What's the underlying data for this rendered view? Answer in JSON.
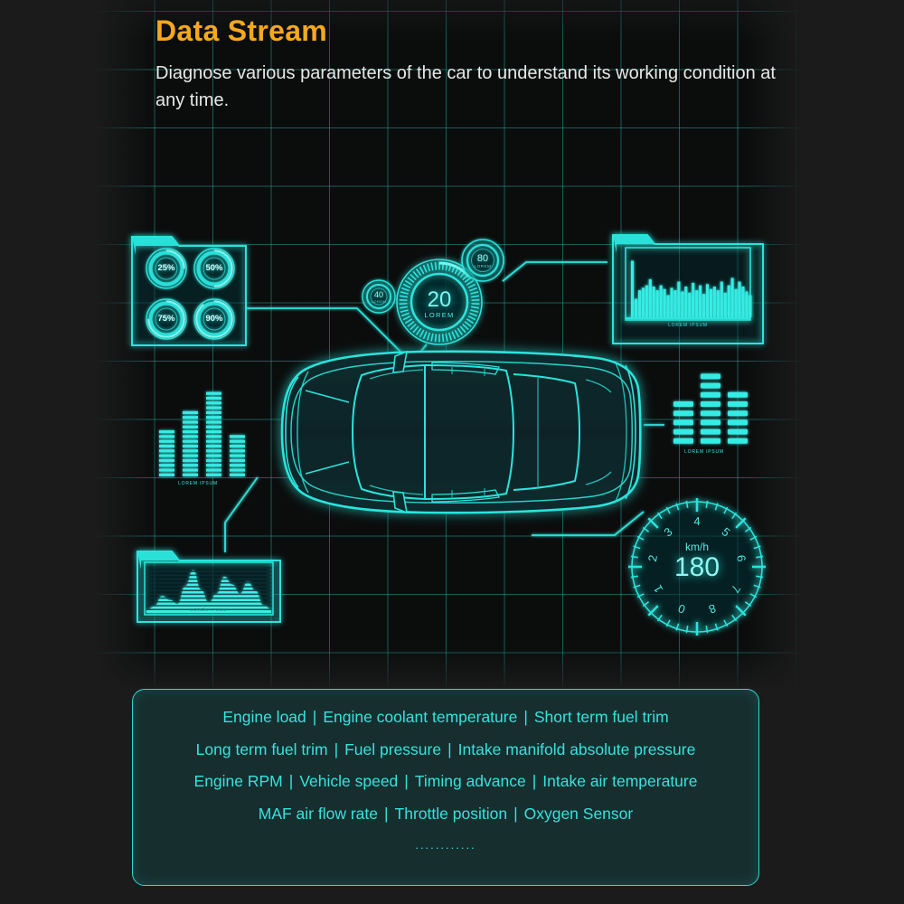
{
  "header": {
    "title": "Data Stream",
    "subtitle": "Diagnose various parameters of the car to understand its working condition at any time.",
    "title_color": "#f5a81c",
    "subtitle_color": "#e8e8e8"
  },
  "theme": {
    "background": "#1b1b1b",
    "grid_color": "#20a096",
    "neon": "#2ff0e6",
    "panel_fill": "#143e40"
  },
  "hud": {
    "percent_panel": {
      "name": "percentage-gauges",
      "values": [
        "25%",
        "50%",
        "75%",
        "90%"
      ]
    },
    "bar_chart_panel": {
      "name": "bar-chart",
      "caption": "LOREM IPSUM",
      "values": [
        92,
        30,
        44,
        48,
        52,
        62,
        50,
        44,
        52,
        46,
        36,
        48,
        44,
        58,
        42,
        50,
        40,
        56,
        44,
        52,
        38,
        54,
        46,
        50,
        44,
        58,
        40,
        52,
        64,
        46,
        58,
        50,
        42,
        36
      ]
    },
    "area_chart_panel": {
      "name": "area-chart",
      "caption": "LOREM IPSUM",
      "values": [
        4,
        10,
        26,
        20,
        14,
        42,
        66,
        36,
        16,
        30,
        56,
        44,
        30,
        48,
        34,
        12,
        6
      ]
    },
    "equalizer_left": {
      "name": "equalizer-left",
      "caption": "LOREM IPSUM",
      "values": [
        58,
        76,
        100,
        52
      ]
    },
    "equalizer_right": {
      "name": "equalizer-right",
      "caption": "LOREM IPSUM",
      "values": [
        62,
        100,
        70
      ]
    },
    "dial_main": {
      "value": "20",
      "label": "LOREM"
    },
    "dial_small_top": {
      "value": "80",
      "label": "LOREM"
    },
    "dial_small_left": {
      "value": "40",
      "label": "LOREM"
    },
    "speedometer": {
      "unit": "km/h",
      "value": "180",
      "ticks": [
        "0",
        "1",
        "2",
        "3",
        "4",
        "5",
        "6",
        "7",
        "8"
      ]
    }
  },
  "parameters": {
    "rows": [
      [
        "Engine load",
        "Engine coolant temperature",
        "Short term fuel trim"
      ],
      [
        "Long term fuel trim",
        "Fuel pressure",
        "Intake manifold absolute pressure"
      ],
      [
        "Engine RPM",
        "Vehicle speed",
        "Timing advance",
        "Intake air temperature"
      ],
      [
        "MAF air flow rate",
        "Throttle position",
        "Oxygen Sensor"
      ]
    ],
    "separator": "|",
    "ellipsis": "............"
  }
}
